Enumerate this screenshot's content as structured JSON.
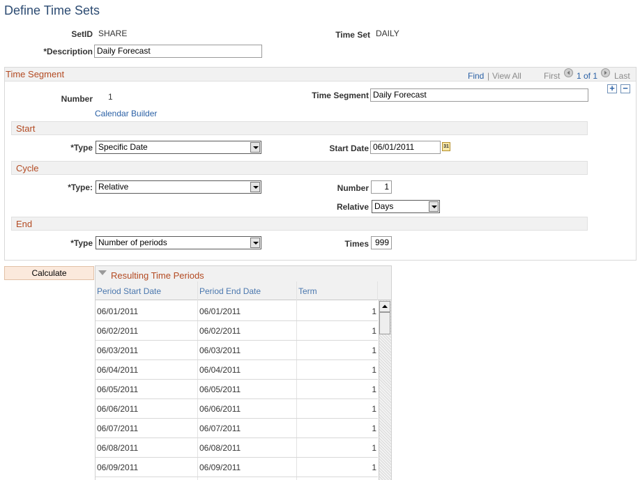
{
  "page": {
    "title": "Define Time Sets"
  },
  "header": {
    "setid_label": "SetID",
    "setid_value": "SHARE",
    "timeset_label": "Time Set",
    "timeset_value": "DAILY",
    "description_label": "*Description",
    "description_value": "Daily Forecast"
  },
  "segment": {
    "title": "Time Segment",
    "nav": {
      "find": "Find",
      "separator": "|",
      "view_all": "View All",
      "first": "First",
      "count": "1 of 1",
      "last": "Last"
    },
    "add_symbol": "+",
    "remove_symbol": "−",
    "number_label": "Number",
    "number_value": "1",
    "time_segment_label": "Time Segment",
    "time_segment_value": "Daily Forecast",
    "calendar_builder": "Calendar Builder",
    "start": {
      "title": "Start",
      "type_label": "*Type",
      "type_value": "Specific Date",
      "start_date_label": "Start Date",
      "start_date_value": "06/01/2011",
      "calendar_glyph": "31"
    },
    "cycle": {
      "title": "Cycle",
      "type_label": "*Type:",
      "type_value": "Relative",
      "number_label": "Number",
      "number_value": "1",
      "relative_label": "Relative",
      "relative_value": "Days"
    },
    "end": {
      "title": "End",
      "type_label": "*Type",
      "type_value": "Number of periods",
      "times_label": "Times",
      "times_value": "999"
    }
  },
  "calculate_label": "Calculate",
  "results": {
    "title": "Resulting Time Periods",
    "columns": [
      "Period Start Date",
      "Period End Date",
      "Term"
    ],
    "rows": [
      [
        "06/01/2011",
        "06/01/2011",
        "1"
      ],
      [
        "06/02/2011",
        "06/02/2011",
        "1"
      ],
      [
        "06/03/2011",
        "06/03/2011",
        "1"
      ],
      [
        "06/04/2011",
        "06/04/2011",
        "1"
      ],
      [
        "06/05/2011",
        "06/05/2011",
        "1"
      ],
      [
        "06/06/2011",
        "06/06/2011",
        "1"
      ],
      [
        "06/07/2011",
        "06/07/2011",
        "1"
      ],
      [
        "06/08/2011",
        "06/08/2011",
        "1"
      ],
      [
        "06/09/2011",
        "06/09/2011",
        "1"
      ]
    ]
  }
}
